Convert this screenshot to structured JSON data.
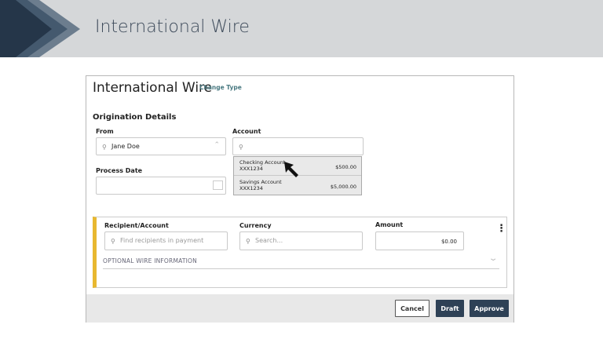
{
  "banner": {
    "title": "International Wire"
  },
  "form": {
    "title": "International Wire",
    "change_type": "Change Type",
    "section": "Origination Details",
    "from": {
      "label": "From",
      "value": "Jane Doe"
    },
    "account": {
      "label": "Account",
      "value": ""
    },
    "process_date": {
      "label": "Process Date",
      "value": ""
    },
    "account_options": [
      {
        "name": "Checking Account",
        "number": "XXX1234",
        "balance": "$500.00"
      },
      {
        "name": "Savings Account",
        "number": "XXX1234",
        "balance": "$5,000.00"
      }
    ]
  },
  "payment": {
    "recipient": {
      "label": "Recipient/Account",
      "placeholder": "Find recipients in payment"
    },
    "currency": {
      "label": "Currency",
      "placeholder": "Search..."
    },
    "amount": {
      "label": "Amount",
      "value": "$0.00"
    },
    "optional": "OPTIONAL WIRE INFORMATION"
  },
  "footer": {
    "cancel": "Cancel",
    "draft": "Draft",
    "approve": "Approve"
  },
  "colors": {
    "accent": "#e8b830",
    "primary": "#2e4156"
  }
}
